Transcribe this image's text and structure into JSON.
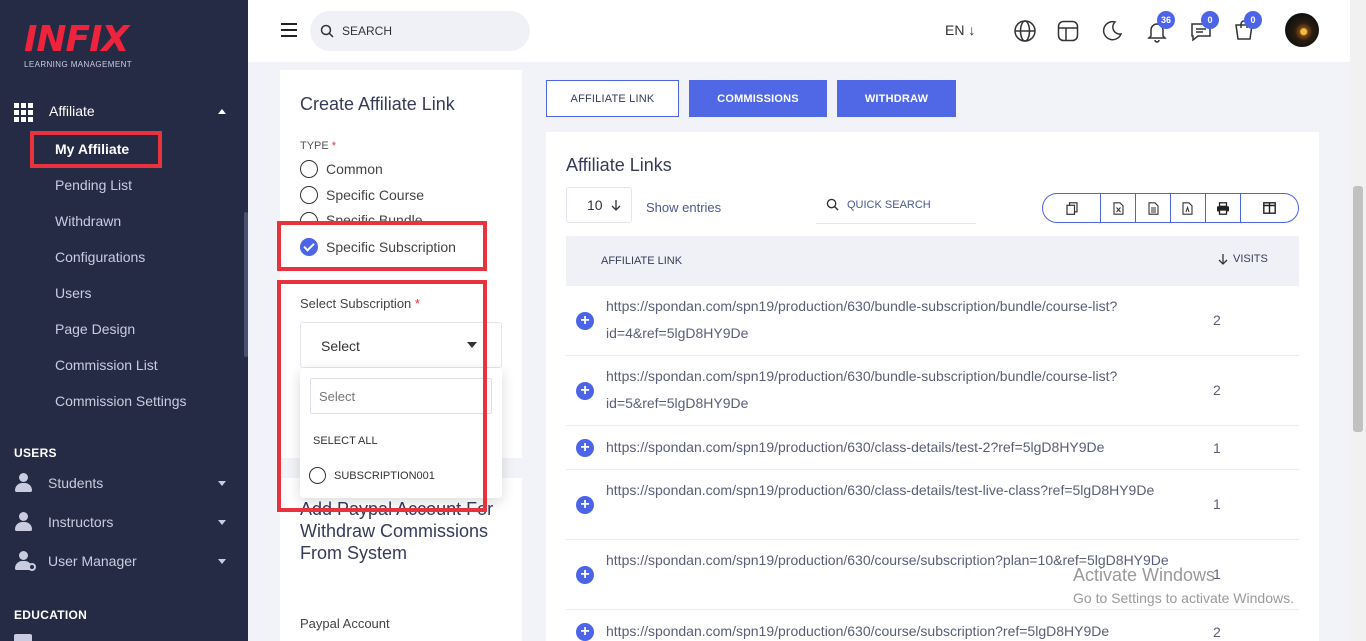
{
  "brand": {
    "logo_text": "INFIX",
    "logo_sub": "LEARNING MANAGEMENT",
    "accent": "#4c64e8",
    "sidebar_bg": "#262b45",
    "highlight": "#e8333d"
  },
  "sidebar": {
    "parent_label": "Affiliate",
    "items": [
      {
        "label": "My Affiliate"
      },
      {
        "label": "Pending List"
      },
      {
        "label": "Withdrawn"
      },
      {
        "label": "Configurations"
      },
      {
        "label": "Users"
      },
      {
        "label": "Page Design"
      },
      {
        "label": "Commission List"
      },
      {
        "label": "Commission Settings"
      }
    ],
    "section_users": "USERS",
    "users_items": [
      {
        "label": "Students"
      },
      {
        "label": "Instructors"
      },
      {
        "label": "User Manager"
      }
    ],
    "section_education": "EDUCATION"
  },
  "topbar": {
    "search_placeholder": "SEARCH",
    "lang": "EN ↓",
    "notifications_count": "36",
    "messages_count": "0",
    "cart_count": "0"
  },
  "create_form": {
    "title": "Create Affiliate Link",
    "type_label": "TYPE",
    "required_mark": "*",
    "type_options": [
      {
        "label": "Common",
        "checked": false
      },
      {
        "label": "Specific Course",
        "checked": false
      },
      {
        "label": "Specific Bundle",
        "checked": false
      },
      {
        "label": "Specific Subscription",
        "checked": true
      }
    ],
    "select_label": "Select Subscription",
    "select_value": "Select",
    "dropdown": {
      "search_placeholder": "Select",
      "select_all": "SELECT ALL",
      "options": [
        "SUBSCRIPTION001"
      ]
    }
  },
  "paypal": {
    "title": "Add Paypal Account For Withdraw Commissions From System",
    "account_label": "Paypal Account"
  },
  "tabs": [
    {
      "label": "AFFILIATE LINK"
    },
    {
      "label": "COMMISSIONS"
    },
    {
      "label": "WITHDRAW"
    }
  ],
  "links_table": {
    "title": "Affiliate Links",
    "entries_value": "10",
    "show_entries": "Show entries",
    "quick_search_placeholder": "QUICK SEARCH",
    "columns": [
      "AFFILIATE LINK",
      "VISITS"
    ],
    "rows": [
      {
        "link": "https://spondan.com/spn19/production/630/bundle-subscription/bundle/course-list?id=4&ref=5lgD8HY9De",
        "visits": "2"
      },
      {
        "link": "https://spondan.com/spn19/production/630/bundle-subscription/bundle/course-list?id=5&ref=5lgD8HY9De",
        "visits": "2"
      },
      {
        "link": "https://spondan.com/spn19/production/630/class-details/test-2?ref=5lgD8HY9De",
        "visits": "1"
      },
      {
        "link": "https://spondan.com/spn19/production/630/class-details/test-live-class?ref=5lgD8HY9De",
        "visits": "1"
      },
      {
        "link": "https://spondan.com/spn19/production/630/course/subscription?plan=10&ref=5lgD8HY9De",
        "visits": "1"
      },
      {
        "link": "https://spondan.com/spn19/production/630/course/subscription?ref=5lgD8HY9De",
        "visits": "2"
      }
    ]
  },
  "watermark": {
    "line1": "Activate Windows",
    "line2": "Go to Settings to activate Windows."
  }
}
